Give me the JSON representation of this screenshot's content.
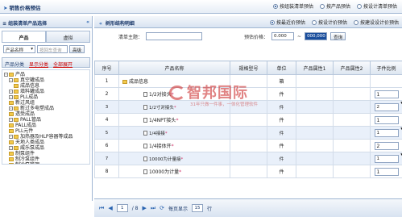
{
  "topbar": {
    "title": "销售价格预估",
    "options": [
      {
        "label": "按组装清单预估",
        "selected": true
      },
      {
        "label": "按产品预估",
        "selected": false
      },
      {
        "label": "按设计清单预估",
        "selected": false
      }
    ]
  },
  "left": {
    "header": "组装清单产品选择",
    "tabs": [
      "产品",
      "虚拟"
    ],
    "search_select": "产品名称",
    "search_placeholder": "按回车查询",
    "search_button": "高级",
    "category_label": "产品分类",
    "show_category": "显示分类",
    "all_products": "全部展开",
    "tree": [
      {
        "label": "产品",
        "level": 0,
        "expander": "-"
      },
      {
        "label": "真空罐成品",
        "level": 1,
        "expander": "-"
      },
      {
        "label": "成品信息",
        "level": 2,
        "expander": ""
      },
      {
        "label": "填料罐成品",
        "level": 1,
        "expander": "-"
      },
      {
        "label": "PLL成品",
        "level": 1,
        "expander": "-"
      },
      {
        "label": "新过风组",
        "level": 1,
        "expander": ""
      },
      {
        "label": "新过多电塑成品",
        "level": 1,
        "expander": "-"
      },
      {
        "label": "透受成品",
        "level": 1,
        "expander": ""
      },
      {
        "label": "PALL管品",
        "level": 1,
        "expander": "-"
      },
      {
        "label": "PALL成品",
        "level": 1,
        "expander": ""
      },
      {
        "label": "PLL元件",
        "level": 1,
        "expander": ""
      },
      {
        "label": "加热器及HLP容器等成品",
        "level": 1,
        "expander": "-"
      },
      {
        "label": "天地人类成品",
        "level": 1,
        "expander": ""
      },
      {
        "label": "威乐泵成品",
        "level": 1,
        "expander": "-"
      },
      {
        "label": "制泵组件",
        "level": 1,
        "expander": ""
      },
      {
        "label": "制冷泵组件",
        "level": 1,
        "expander": ""
      },
      {
        "label": "制冷泵管理",
        "level": 1,
        "expander": ""
      },
      {
        "label": "加热器及HLP容器等",
        "level": 1,
        "expander": ""
      },
      {
        "label": "制冷泵组件",
        "level": 1,
        "expander": ""
      }
    ]
  },
  "right": {
    "header": "树形结构明细",
    "options": [
      {
        "label": "按最近价预估",
        "selected": true
      },
      {
        "label": "按设计价预估",
        "selected": false
      },
      {
        "label": "按建设设计价预估",
        "selected": false
      }
    ],
    "filter": {
      "theme_label": "清单主题：",
      "price_label": "预估价格：",
      "price_from": "0.000",
      "price_to": "000,000",
      "button": "查询"
    },
    "columns": [
      "序号",
      "产品名称",
      "规格型号",
      "单位",
      "产品属性1",
      "产品属性2",
      "子件比例"
    ],
    "rows": [
      {
        "no": "1",
        "name": "成品信息",
        "model": "",
        "unit": "箱",
        "attr1": "",
        "attr2": "",
        "ratio": "",
        "type": "folder"
      },
      {
        "no": "2",
        "name": "1/2对接头",
        "model": "",
        "unit": "件",
        "attr1": "",
        "attr2": "",
        "ratio": "1",
        "type": "doc"
      },
      {
        "no": "3",
        "name": "1/2寸对接头",
        "model": "",
        "unit": "件",
        "attr1": "",
        "attr2": "",
        "ratio": "2",
        "type": "doc"
      },
      {
        "no": "4",
        "name": "1/4NPT接头",
        "model": "",
        "unit": "件",
        "attr1": "",
        "attr2": "",
        "ratio": "1",
        "type": "doc"
      },
      {
        "no": "5",
        "name": "1/4接接",
        "model": "",
        "unit": "件",
        "attr1": "",
        "attr2": "",
        "ratio": "1",
        "type": "doc"
      },
      {
        "no": "6",
        "name": "1/4接体开",
        "model": "",
        "unit": "件",
        "attr1": "",
        "attr2": "",
        "ratio": "2",
        "type": "doc"
      },
      {
        "no": "7",
        "name": "10000为计量接",
        "model": "",
        "unit": "件",
        "attr1": "",
        "attr2": "",
        "ratio": "1",
        "type": "doc"
      },
      {
        "no": "8",
        "name": "10000为计量",
        "model": "",
        "unit": "件",
        "attr1": "",
        "attr2": "",
        "ratio": "1",
        "type": "doc"
      }
    ],
    "pager": {
      "page": "1",
      "of": "/ 8",
      "per_page_label": "每页显示",
      "per_page": "15",
      "unit": "行"
    }
  },
  "watermark": {
    "text": "智邦国际",
    "sub": "31年只做一件事，一体化管理软件"
  }
}
